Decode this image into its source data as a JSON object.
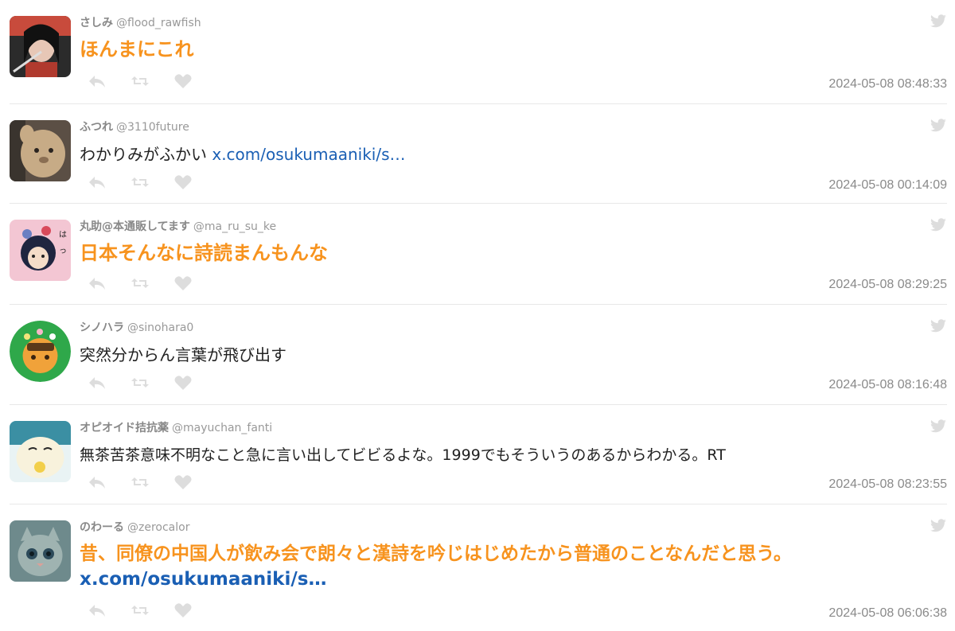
{
  "tweets": [
    {
      "name": "さしみ",
      "handle": "@flood_rawfish",
      "text": "ほんまにこれ",
      "link": "",
      "time": "2024-05-08 08:48:33",
      "style": "big"
    },
    {
      "name": "ふつれ",
      "handle": "@3110future",
      "text": "わかりみがふかい",
      "link": "x.com/osukumaaniki/s…",
      "time": "2024-05-08 00:14:09",
      "style": "normal"
    },
    {
      "name": "丸助@本通販してます",
      "handle": "@ma_ru_su_ke",
      "text": "日本そんなに詩読まんもんな",
      "link": "",
      "time": "2024-05-08 08:29:25",
      "style": "big"
    },
    {
      "name": "シノハラ",
      "handle": "@sinohara0",
      "text": "突然分からん言葉が飛び出す",
      "link": "",
      "time": "2024-05-08 08:16:48",
      "style": "normal"
    },
    {
      "name": "オピオイド拮抗薬",
      "handle": "@mayuchan_fanti",
      "text": "無茶苦茶意味不明なこと急に言い出してビビるよな。1999でもそういうのあるからわかる。RT",
      "link": "",
      "time": "2024-05-08 08:23:55",
      "style": "normal"
    },
    {
      "name": "のわーる",
      "handle": "@zerocalor",
      "text": "昔、同僚の中国人が飲み会で朗々と漢詩を吟じはじめたから普通のことなんだと思う。",
      "link": "x.com/osukumaaniki/s…",
      "time": "2024-05-08 06:06:38",
      "style": "big"
    }
  ],
  "icons": {
    "reply": "reply-icon",
    "retweet": "retweet-icon",
    "like": "heart-icon",
    "source": "twitter-bird-icon"
  },
  "colors": {
    "highlight": "#f7931e",
    "link": "#1a5fb4",
    "muted": "#888888",
    "icon": "#dddddd"
  }
}
